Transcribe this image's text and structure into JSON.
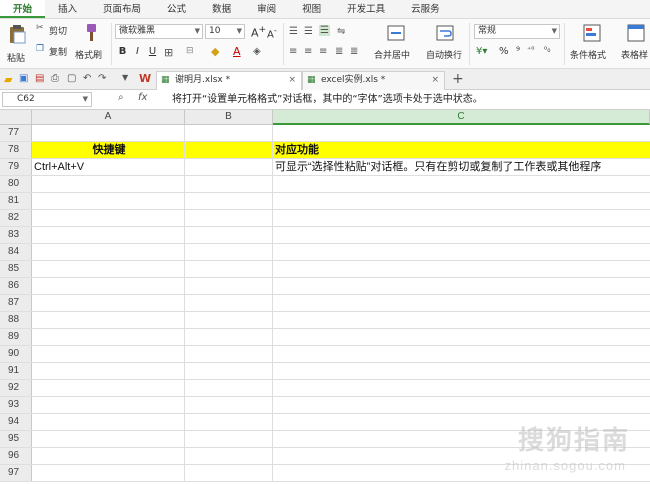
{
  "menu": {
    "tabs": [
      "开始",
      "插入",
      "页面布局",
      "公式",
      "数据",
      "审阅",
      "视图",
      "开发工具",
      "云服务"
    ]
  },
  "ribbon": {
    "paste": "粘贴",
    "cut": "剪切",
    "copy": "复制",
    "format_painter": "格式刷",
    "font_name": "微软雅黑",
    "font_size": "10",
    "bold": "B",
    "italic": "I",
    "underline": "U",
    "merge_center": "合并居中",
    "wrap_text": "自动换行",
    "number_format": "常规",
    "percent": "%",
    "comma": "⁹",
    "cond_format": "条件格式",
    "table_style": "表格样"
  },
  "doc_tabs": [
    {
      "label": "谢明月.xlsx *",
      "active": true
    },
    {
      "label": "excel实例.xls *",
      "active": false
    }
  ],
  "formula_bar": {
    "name_box": "C62",
    "fx": "fx",
    "content": "将打开“设置单元格格式”对话框，其中的“字体”选项卡处于选中状态。"
  },
  "columns": [
    "A",
    "B",
    "C"
  ],
  "selected_column": "C",
  "rows": [
    {
      "num": "77",
      "a": "",
      "c": ""
    },
    {
      "num": "78",
      "a": "快捷键",
      "c": "对应功能",
      "highlight": true
    },
    {
      "num": "79",
      "a": "Ctrl+Alt+V",
      "c": "可显示“选择性粘贴”对话框。只有在剪切或复制了工作表或其他程序"
    },
    {
      "num": "80",
      "a": "",
      "c": ""
    },
    {
      "num": "81",
      "a": "",
      "c": ""
    },
    {
      "num": "82",
      "a": "",
      "c": ""
    },
    {
      "num": "83",
      "a": "",
      "c": ""
    },
    {
      "num": "84",
      "a": "",
      "c": ""
    },
    {
      "num": "85",
      "a": "",
      "c": ""
    },
    {
      "num": "86",
      "a": "",
      "c": ""
    },
    {
      "num": "87",
      "a": "",
      "c": ""
    },
    {
      "num": "88",
      "a": "",
      "c": ""
    },
    {
      "num": "89",
      "a": "",
      "c": ""
    },
    {
      "num": "90",
      "a": "",
      "c": ""
    },
    {
      "num": "91",
      "a": "",
      "c": ""
    },
    {
      "num": "92",
      "a": "",
      "c": ""
    },
    {
      "num": "93",
      "a": "",
      "c": ""
    },
    {
      "num": "94",
      "a": "",
      "c": ""
    },
    {
      "num": "95",
      "a": "",
      "c": ""
    },
    {
      "num": "96",
      "a": "",
      "c": ""
    },
    {
      "num": "97",
      "a": "",
      "c": ""
    }
  ],
  "watermark": {
    "main": "搜狗指南",
    "sub": "zhinan.sogou.com"
  },
  "colors": {
    "accent": "#3a9a3a",
    "highlight": "#ffff00"
  }
}
